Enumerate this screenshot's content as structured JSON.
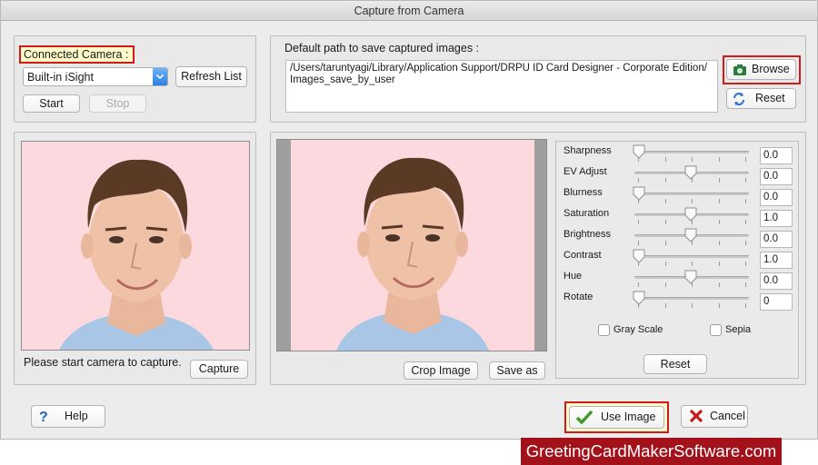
{
  "window": {
    "title": "Capture from Camera"
  },
  "camera": {
    "connected_label": "Connected Camera :",
    "selected_camera": "Built-in iSight",
    "refresh_label": "Refresh List",
    "start_label": "Start",
    "stop_label": "Stop"
  },
  "path": {
    "heading": "Default path to save captured images :",
    "value": "/Users/taruntyagi/Library/Application Support/DRPU ID Card Designer - Corporate Edition/\nImages_save_by_user",
    "browse_label": "Browse",
    "reset_label": "Reset"
  },
  "capture": {
    "status_text": "Please start camera to capture.",
    "capture_label": "Capture"
  },
  "edit": {
    "crop_label": "Crop Image",
    "saveas_label": "Save as"
  },
  "adjustments": {
    "sliders": [
      {
        "label": "Sharpness",
        "value": "0.0",
        "level": 0.0
      },
      {
        "label": "EV Adjust",
        "value": "0.0",
        "level": 0.5
      },
      {
        "label": "Blurness",
        "value": "0.0",
        "level": 0.0
      },
      {
        "label": "Saturation",
        "value": "1.0",
        "level": 0.5
      },
      {
        "label": "Brightness",
        "value": "0.0",
        "level": 0.5
      },
      {
        "label": "Contrast",
        "value": "1.0",
        "level": 0.0
      },
      {
        "label": "Hue",
        "value": "0.0",
        "level": 0.5
      },
      {
        "label": "Rotate",
        "value": "0",
        "level": 0.0
      }
    ],
    "grayscale_label": "Gray Scale",
    "sepia_label": "Sepia",
    "reset_label": "Reset"
  },
  "footer": {
    "help_label": "Help",
    "use_image_label": "Use Image",
    "cancel_label": "Cancel"
  },
  "watermark": "GreetingCardMakerSoftware.com",
  "colors": {
    "accent_red": "#d11a1a",
    "highlight_yellow": "#fdf9c9",
    "photo_bg": "#fbd9de",
    "watermark_bg": "#a3121a"
  }
}
